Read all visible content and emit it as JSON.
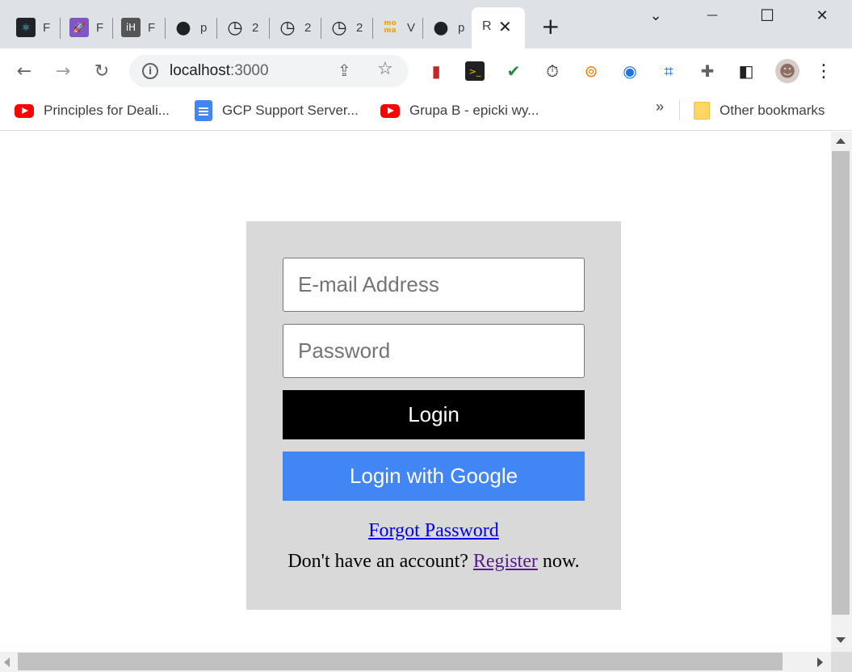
{
  "tabs": [
    {
      "title": "F",
      "icon": "react-icon",
      "bg": "#20232a",
      "fg": "#61dafb",
      "glyph": "⚛"
    },
    {
      "title": "F",
      "icon": "rocket-icon",
      "bg": "#7e57c2",
      "fg": "#ffffff",
      "glyph": "🚀"
    },
    {
      "title": "F",
      "icon": "ih-icon",
      "bg": "#555555",
      "fg": "#ffffff",
      "glyph": "iH"
    },
    {
      "title": "p",
      "icon": "github-icon",
      "bg": "transparent",
      "fg": "#202124",
      "glyph": "●"
    },
    {
      "title": "2",
      "icon": "clock-icon",
      "bg": "transparent",
      "fg": "#202124",
      "glyph": "◷"
    },
    {
      "title": "2",
      "icon": "clock-icon",
      "bg": "transparent",
      "fg": "#202124",
      "glyph": "◷"
    },
    {
      "title": "2",
      "icon": "clock-icon",
      "bg": "transparent",
      "fg": "#202124",
      "glyph": "◷"
    },
    {
      "title": "V",
      "icon": "moma-icon",
      "bg": "transparent",
      "fg": "#f4a300",
      "glyph": "mo\nma"
    },
    {
      "title": "p",
      "icon": "github-icon",
      "bg": "transparent",
      "fg": "#202124",
      "glyph": "●"
    }
  ],
  "active_tab": {
    "title": "R",
    "close": "✕"
  },
  "new_tab": "+",
  "window_controls": {
    "tab_search": "⌄",
    "minimize": "—",
    "maximize": "☐",
    "close": "✕"
  },
  "toolbar": {
    "back": "←",
    "forward": "→",
    "reload": "↻",
    "info": "i",
    "url_host": "localhost",
    "url_port": ":3000",
    "share": "⇪",
    "star": "☆"
  },
  "extensions": [
    {
      "name": "sd-card-extension-icon",
      "glyph": "▮",
      "color": "#c62828"
    },
    {
      "name": "terminal-extension-icon",
      "glyph": ">_",
      "color": "#202124"
    },
    {
      "name": "check-extension-icon",
      "glyph": "✔",
      "color": "#1e8e3e"
    },
    {
      "name": "stopwatch-extension-icon",
      "glyph": "⏱",
      "color": "#202124"
    },
    {
      "name": "vpn-extension-icon",
      "glyph": "⊚",
      "color": "#f57c00"
    },
    {
      "name": "aperture-extension-icon",
      "glyph": "◉",
      "color": "#1a73e8"
    },
    {
      "name": "crop-extension-icon",
      "glyph": "⌗",
      "color": "#1a73e8"
    },
    {
      "name": "puzzle-extensions-icon",
      "glyph": "✚",
      "color": "#5f6368"
    },
    {
      "name": "side-panel-icon",
      "glyph": "◧",
      "color": "#202124"
    },
    {
      "name": "profile-avatar-icon",
      "glyph": "☻",
      "color": "#8d6e63"
    },
    {
      "name": "kebab-menu-icon",
      "glyph": "⋮",
      "color": "#202124"
    }
  ],
  "bookmarks": {
    "items": [
      {
        "label": "Principles for Deali...",
        "icon": "youtube-icon"
      },
      {
        "label": "GCP Support Server...",
        "icon": "google-docs-icon"
      },
      {
        "label": "Grupa B - epicki wy...",
        "icon": "youtube-icon"
      }
    ],
    "overflow": "»",
    "other": "Other bookmarks"
  },
  "login": {
    "email_placeholder": "E-mail Address",
    "email_value": "",
    "password_placeholder": "Password",
    "password_value": "",
    "login_button": "Login",
    "google_button": "Login with Google",
    "forgot_link": "Forgot Password",
    "register_prefix": "Don't have an account?",
    "register_link": "Register",
    "register_suffix": "now."
  },
  "colors": {
    "google_blue": "#4285f4",
    "login_black": "#000000",
    "card_gray": "#d9d9d9",
    "link_blue": "#0000ee",
    "link_visited": "#551a8b"
  }
}
